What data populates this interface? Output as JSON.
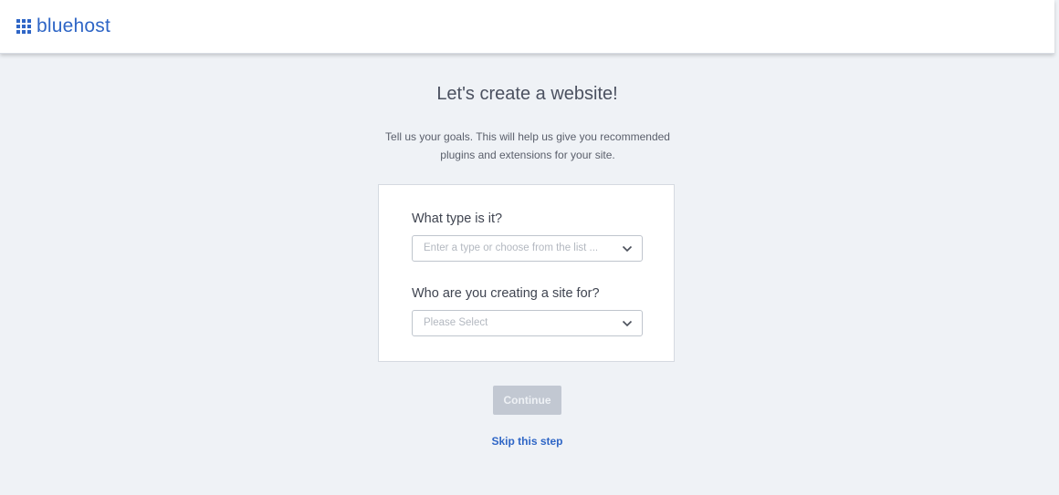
{
  "header": {
    "brand": "bluehost",
    "logo_icon": "grid-icon",
    "brand_color": "#2f66c6"
  },
  "main": {
    "title": "Let's create a website!",
    "subtitle": "Tell us your goals. This will help us give you recommended plugins and extensions for your site."
  },
  "form": {
    "type_label": "What type is it?",
    "type_placeholder": "Enter a type or choose from the list ...",
    "audience_label": "Who are you creating a site for?",
    "audience_placeholder": "Please Select",
    "dropdown_icon": "chevron-down-icon"
  },
  "actions": {
    "continue_label": "Continue",
    "continue_disabled": true,
    "skip_label": "Skip this step"
  },
  "colors": {
    "background": "#eff2f6",
    "button_disabled": "#c2c8d2",
    "link": "#2f66c6"
  }
}
